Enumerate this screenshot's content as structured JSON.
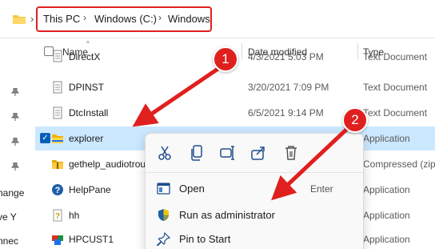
{
  "address_bar": {
    "crumbs": [
      "This PC",
      "Windows (C:)",
      "Windows"
    ]
  },
  "nav": {
    "partial_labels": [
      "hange",
      "ve Y",
      "nnec"
    ]
  },
  "columns": {
    "name": "Name",
    "date_modified": "Date modified",
    "type": "Type"
  },
  "files": [
    {
      "name": "DirectX",
      "date": "4/3/2021 5:03 PM",
      "type": "Text Document",
      "icon": "text-document-icon"
    },
    {
      "name": "DPINST",
      "date": "3/20/2021 7:09 PM",
      "type": "Text Document",
      "icon": "text-document-icon"
    },
    {
      "name": "DtcInstall",
      "date": "6/5/2021 9:14 PM",
      "type": "Text Document",
      "icon": "text-document-icon"
    },
    {
      "name": "explorer",
      "date": "",
      "type": "Application",
      "icon": "folder-app-icon",
      "selected": true
    },
    {
      "name": "gethelp_audiotrou",
      "date": "",
      "type": "Compressed (zipp",
      "icon": "zip-folder-icon"
    },
    {
      "name": "HelpPane",
      "date": "",
      "type": "Application",
      "icon": "help-icon"
    },
    {
      "name": "hh",
      "date": "",
      "type": "Application",
      "icon": "help-file-icon"
    },
    {
      "name": "HPCUST1",
      "date": "",
      "type": "Application",
      "icon": "hp-app-icon"
    }
  ],
  "context_menu": {
    "icons": [
      "cut-icon",
      "copy-icon",
      "rename-icon",
      "share-icon",
      "delete-icon"
    ],
    "items": [
      {
        "label": "Open",
        "shortcut": "Enter",
        "icon": "open-app-icon"
      },
      {
        "label": "Run as administrator",
        "shortcut": "",
        "icon": "uac-shield-icon"
      },
      {
        "label": "Pin to Start",
        "shortcut": "",
        "icon": "pin-icon"
      }
    ]
  },
  "callouts": [
    "1",
    "2"
  ],
  "colors": {
    "accent_red": "#e0201f",
    "selection": "#cce8ff",
    "checkbox": "#005fb8"
  }
}
